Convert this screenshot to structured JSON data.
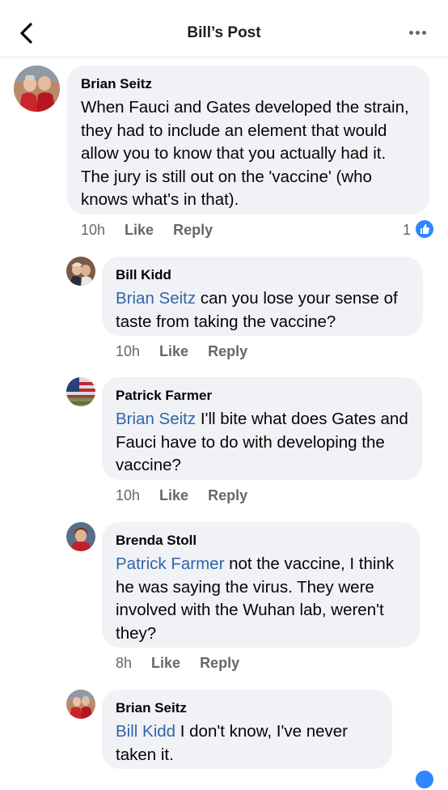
{
  "header": {
    "title": "Bill’s Post"
  },
  "comments": [
    {
      "author": "Brian Seitz",
      "mention": "",
      "text": "When Fauci and Gates developed the strain, they had to include an element that would allow you to know that you actually had it. The jury is still out on the 'vaccine' (who knows what's in that).",
      "time": "10h",
      "like": "Like",
      "reply": "Reply",
      "reaction_count": "1"
    },
    {
      "author": "Bill Kidd",
      "mention": "Brian Seitz",
      "text": " can you lose your sense of taste from taking the vaccine?",
      "time": "10h",
      "like": "Like",
      "reply": "Reply"
    },
    {
      "author": "Patrick Farmer",
      "mention": "Brian Seitz",
      "text": " I'll bite what does Gates and Fauci have to do with developing the vaccine?",
      "time": "10h",
      "like": "Like",
      "reply": "Reply"
    },
    {
      "author": "Brenda Stoll",
      "mention": "Patrick Farmer",
      "text": " not the vaccine,  I think he was saying the virus. They were involved with the Wuhan lab, weren't they?",
      "time": "8h",
      "like": "Like",
      "reply": "Reply"
    },
    {
      "author": "Brian Seitz",
      "mention": "Bill Kidd",
      "text": " I don't know, I've never taken it.",
      "time": "",
      "like": "",
      "reply": ""
    }
  ],
  "colors": {
    "mention": "#3265a8",
    "bubble": "#f0f2f5",
    "like_blue": "#2d88ff"
  }
}
